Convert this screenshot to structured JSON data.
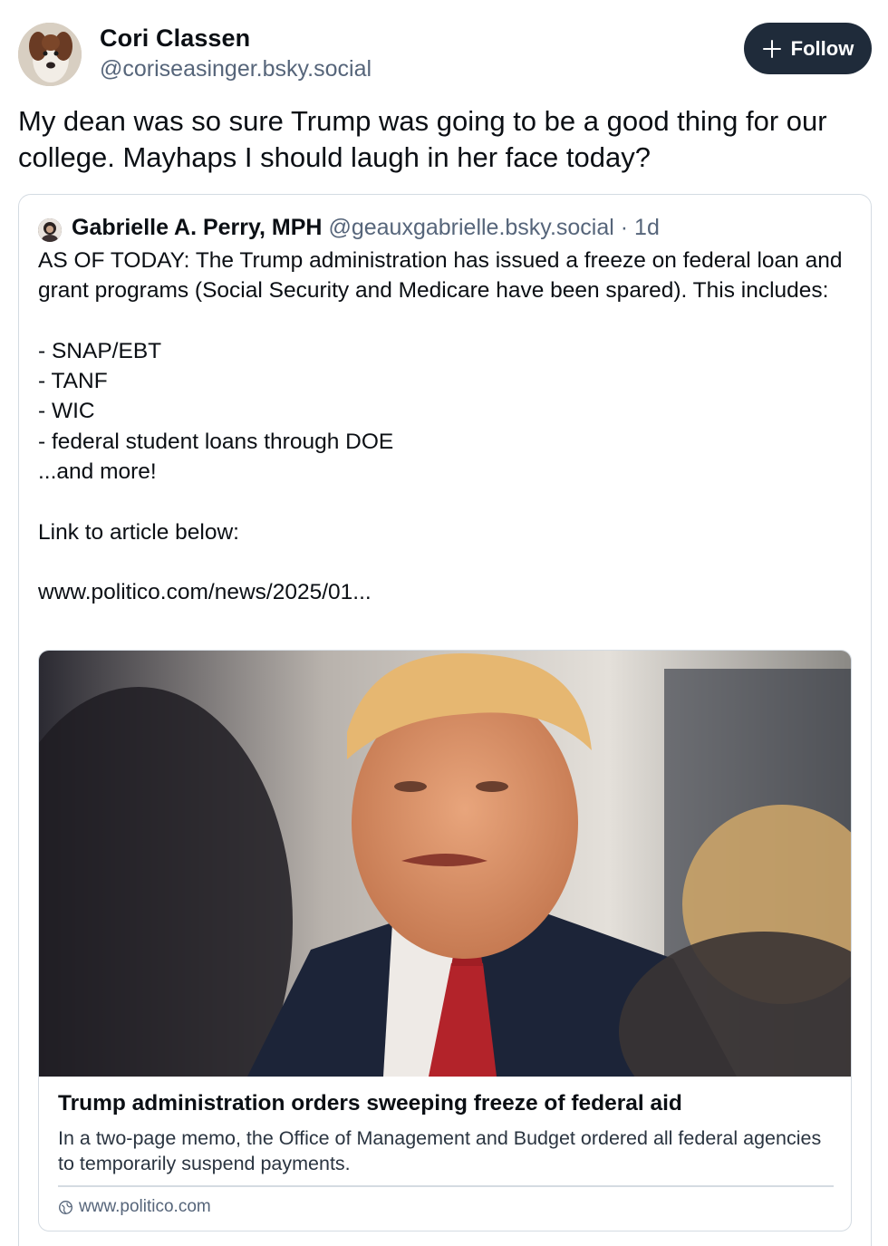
{
  "author": {
    "name": "Cori Classen",
    "handle": "@coriseasinger.bsky.social"
  },
  "follow_button": {
    "label": "Follow",
    "icon": "plus-icon"
  },
  "post": {
    "text": "My dean was so sure Trump was going to be a good thing for our college. Mayhaps I should laugh in her face today?"
  },
  "quoted_post": {
    "author_name": "Gabrielle A. Perry, MPH",
    "author_handle": "@geauxgabrielle.bsky.social",
    "separator": "·",
    "time": "1d",
    "body": "AS OF TODAY: The Trump administration has issued a freeze on federal loan and grant programs (Social Security and Medicare have been spared). This includes:\n\n- SNAP/EBT\n- TANF\n- WIC\n- federal student loans through DOE\n...and more!\n\nLink to article below:\n\nwww.politico.com/news/2025/01...",
    "link_card": {
      "title": "Trump administration orders sweeping freeze of federal aid",
      "description": "In a two-page memo, the Office of Management and Budget ordered all federal agencies to temporarily suspend payments.",
      "domain": "www.politico.com",
      "domain_icon": "globe-icon"
    }
  }
}
